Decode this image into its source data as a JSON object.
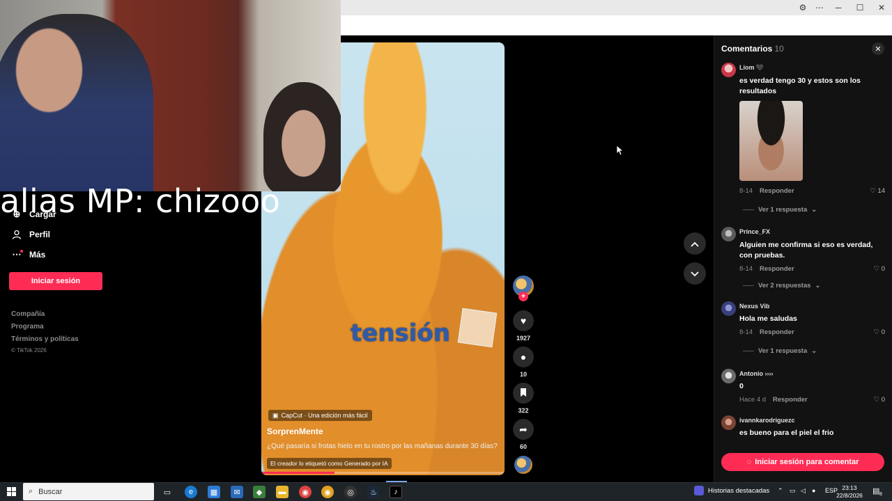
{
  "window": {
    "controls": [
      "─",
      "☐",
      "✕"
    ]
  },
  "webcam": {
    "overlay_text": "alias MP: chizooo"
  },
  "nav": {
    "items": [
      {
        "label": "Cargar",
        "icon": "upload-icon"
      },
      {
        "label": "Perfil",
        "icon": "profile-icon"
      },
      {
        "label": "Más",
        "icon": "more-icon"
      }
    ],
    "login_label": "Iniciar sesión",
    "footer": [
      "Compañía",
      "Programa",
      "Términos y políticas",
      "© TikTok 2026"
    ]
  },
  "video": {
    "overlay_word": "tensión",
    "capcut_label": "CapCut · Una edición más fácil",
    "author": "SorprenMente",
    "description": "¿Qué pasaría si frotas hielo en tu rostro por las mañanas durante 30 días?",
    "ai_label": "El creador lo etiquetó como Generado por IA",
    "progress": 0.3
  },
  "actions": {
    "likes": "1927",
    "comments": "10",
    "saves": "322",
    "shares": "60"
  },
  "comments_panel": {
    "title": "Comentarios",
    "count": "10",
    "login_button": "Iniciar sesión para comentar",
    "items": [
      {
        "user": "Liom",
        "badge": "🖤",
        "text": "es verdad tengo 30 y estos son los resultados",
        "date": "8-14",
        "reply": "Responder",
        "likes": "14",
        "more": "Ver 1 respuesta"
      },
      {
        "user": "Prince_FX",
        "text": "Alguien me confirma si eso es verdad, con pruebas.",
        "date": "8-14",
        "reply": "Responder",
        "likes": "0",
        "more": "Ver 2 respuestas"
      },
      {
        "user": "Nexus Vib",
        "text": "Hola me saludas",
        "date": "8-14",
        "reply": "Responder",
        "likes": "0",
        "more": "Ver 1 respuesta"
      },
      {
        "user": "Antonio ››››",
        "text": "0",
        "date": "Hace 4 d",
        "reply": "Responder",
        "likes": "0"
      },
      {
        "user": "ivannkarodriguezc",
        "text": "es bueno para el piel el frio"
      }
    ]
  },
  "taskbar": {
    "search_placeholder": "Buscar",
    "news": "Historias destacadas",
    "lang": "ESP",
    "time": "23:13",
    "date": "22/8/2026",
    "notification_count": "8"
  }
}
